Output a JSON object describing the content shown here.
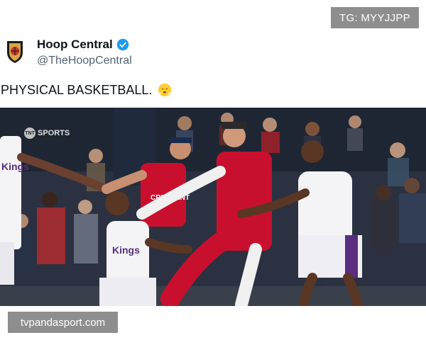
{
  "watermarks": {
    "top": "TG: MYYJJPP",
    "bottom": "tvpandasport.com"
  },
  "account": {
    "display_name": "Hoop Central",
    "handle": "@TheHoopCentral",
    "verified": true,
    "avatar_icon": "basketball-crest-icon"
  },
  "tweet": {
    "text": "PHYSICAL BASKETBALL.",
    "emoji": "face-with-steam-icon"
  },
  "media": {
    "network_logo": "SPORTS",
    "network_mark": "TNT",
    "jersey_text": [
      "Kings",
      "CRESCENT",
      "Kings"
    ]
  },
  "colors": {
    "red_jersey": "#c8102e",
    "white_jersey": "#f4f4f6",
    "purple_trim": "#5a2d81",
    "verified_blue": "#1d9bf0",
    "watermark_gray": "#8e8e8e"
  }
}
